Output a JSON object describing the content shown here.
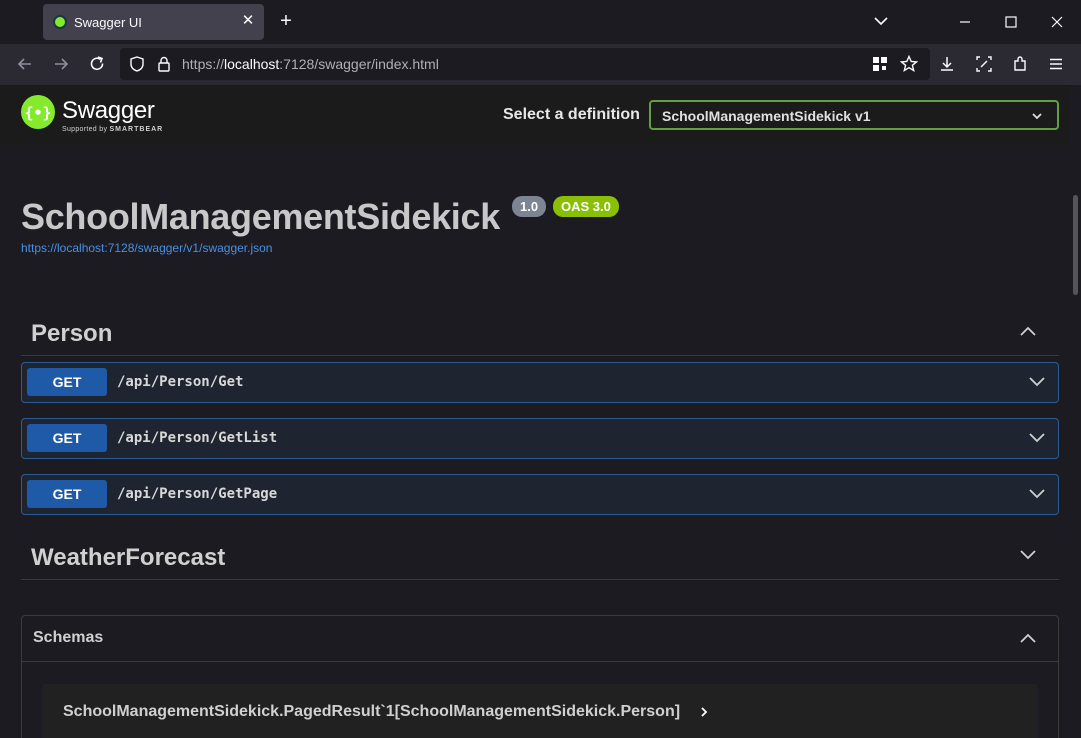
{
  "browser": {
    "tab_title": "Swagger UI",
    "url_prefix": "https://",
    "url_host": "localhost",
    "url_rest": ":7128/swagger/index.html"
  },
  "topbar": {
    "logo_text": "Swagger",
    "logo_sub_prefix": "Supported by ",
    "logo_sub_brand": "SMARTBEAR",
    "definition_label": "Select a definition",
    "definition_value": "SchoolManagementSidekick v1"
  },
  "info": {
    "title": "SchoolManagementSidekick",
    "version": "1.0",
    "oas": "OAS 3.0",
    "spec_url": "https://localhost:7128/swagger/v1/swagger.json"
  },
  "tags": [
    {
      "name": "Person",
      "expanded": true,
      "operations": [
        {
          "method": "GET",
          "path": "/api/Person/Get"
        },
        {
          "method": "GET",
          "path": "/api/Person/GetList"
        },
        {
          "method": "GET",
          "path": "/api/Person/GetPage"
        }
      ]
    },
    {
      "name": "WeatherForecast",
      "expanded": false,
      "operations": []
    }
  ],
  "schemas": {
    "title": "Schemas",
    "models": [
      {
        "name": "SchoolManagementSidekick.PagedResult`1[SchoolManagementSidekick.Person]"
      }
    ]
  },
  "colors": {
    "get_method": "#1f5aa8",
    "swagger_green": "#85ea2d",
    "oas_badge": "#89bf04",
    "link": "#4990e2"
  },
  "icons": [
    "globe-favicon-icon",
    "close-icon",
    "plus-icon",
    "chevron-down-icon",
    "minimize-icon",
    "maximize-icon",
    "back-arrow-icon",
    "forward-arrow-icon",
    "reload-icon",
    "shield-icon",
    "lock-icon",
    "qr-code-icon",
    "star-icon",
    "download-icon",
    "screenshot-icon",
    "extensions-icon",
    "menu-icon",
    "chevron-up-icon",
    "chevron-right-icon"
  ]
}
